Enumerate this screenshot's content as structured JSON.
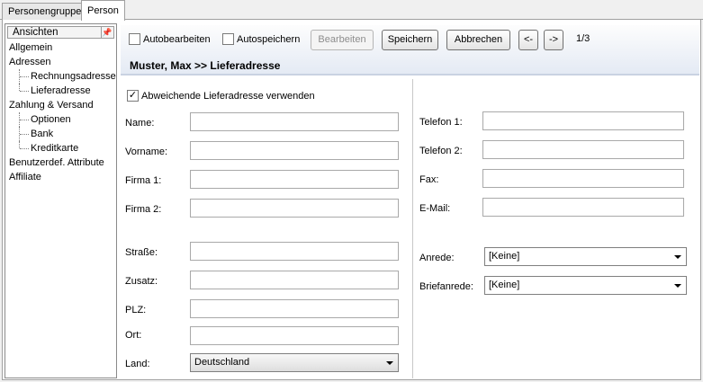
{
  "tabs": [
    {
      "label": "Personengruppe"
    },
    {
      "label": "Person"
    }
  ],
  "views": {
    "title": "Ansichten",
    "pin_icon": "pin-icon",
    "items": [
      {
        "label": "Allgemein"
      },
      {
        "label": "Adressen"
      },
      {
        "label": "Rechnungsadresse"
      },
      {
        "label": "Lieferadresse"
      },
      {
        "label": "Zahlung & Versand"
      },
      {
        "label": "Optionen"
      },
      {
        "label": "Bank"
      },
      {
        "label": "Kreditkarte"
      },
      {
        "label": "Benutzerdef. Attribute"
      },
      {
        "label": "Affiliate"
      }
    ]
  },
  "toolbar": {
    "autobearbeiten": {
      "label": "Autobearbeiten",
      "checked": false
    },
    "autospeichern": {
      "label": "Autospeichern",
      "checked": false
    },
    "bearbeiten": "Bearbeiten",
    "speichern": "Speichern",
    "abbrechen": "Abbrechen",
    "prev": "<-",
    "next": "->",
    "pager": "1/3"
  },
  "breadcrumb": "Muster, Max >> Lieferadresse",
  "form": {
    "abweichende": {
      "label": "Abweichende Lieferadresse verwenden",
      "checked": true,
      "mark": "✓"
    },
    "labels": {
      "name": "Name:",
      "vorname": "Vorname:",
      "firma1": "Firma 1:",
      "firma2": "Firma 2:",
      "strasse": "Straße:",
      "zusatz": "Zusatz:",
      "plz": "PLZ:",
      "ort": "Ort:",
      "land": "Land:",
      "telefon1": "Telefon 1:",
      "telefon2": "Telefon 2:",
      "fax": "Fax:",
      "email": "E-Mail:",
      "anrede": "Anrede:",
      "briefanrede": "Briefanrede:"
    },
    "values": {
      "name": "",
      "vorname": "",
      "firma1": "",
      "firma2": "",
      "strasse": "",
      "zusatz": "",
      "plz": "",
      "ort": "",
      "telefon1": "",
      "telefon2": "",
      "fax": "",
      "email": ""
    },
    "land": "Deutschland",
    "anrede": "[Keine]",
    "briefanrede": "[Keine]"
  }
}
